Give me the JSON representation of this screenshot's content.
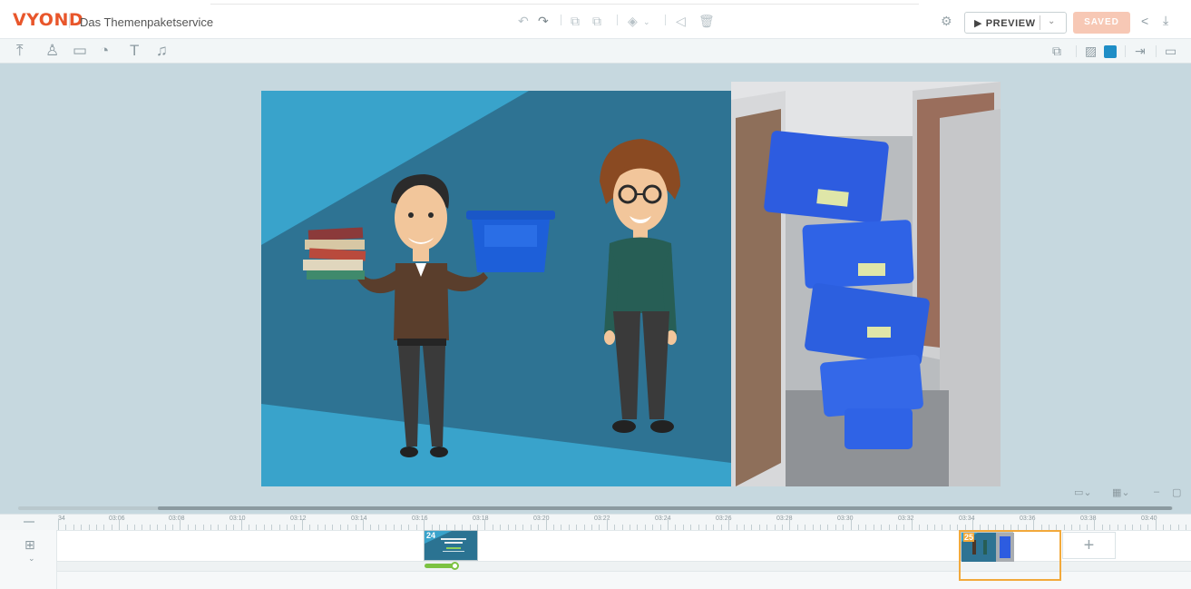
{
  "app": {
    "logo": "VYOND",
    "project_title": "Das Themenpaketservice"
  },
  "header": {
    "preview_label": "PREVIEW",
    "saved_label": "SAVED",
    "icons": [
      "undo-icon",
      "redo-icon",
      "copy-icon",
      "paste-icon",
      "layer-order-icon",
      "flip-icon",
      "delete-icon",
      "settings-icon",
      "share-icon",
      "download-icon"
    ]
  },
  "toolbar2": {
    "left_icons": [
      "upload-icon",
      "character-icon",
      "prop-icon",
      "chart-icon",
      "text-icon",
      "audio-icon"
    ],
    "right_icons": [
      "swap-icon",
      "background-icon",
      "enter-effect-icon",
      "camera-icon"
    ],
    "background_color": "#1f8ec6"
  },
  "timeline": {
    "ruler_labels": [
      "34",
      "03:06",
      "03:08",
      "03:10",
      "03:12",
      "03:14",
      "03:16",
      "03:18",
      "03:20",
      "03:22",
      "03:24",
      "03:26",
      "03:28",
      "03:30",
      "03:32",
      "03:34",
      "03:36",
      "03:38",
      "03:40"
    ],
    "scenes": [
      {
        "number": "24"
      },
      {
        "number": "25"
      }
    ],
    "add_scene_label": "+"
  },
  "colors": {
    "accent": "#e8562b",
    "stage_dark": "#2e7393",
    "stage_light": "#39a3cb",
    "selection": "#f2a93b",
    "progress": "#7cc242"
  }
}
